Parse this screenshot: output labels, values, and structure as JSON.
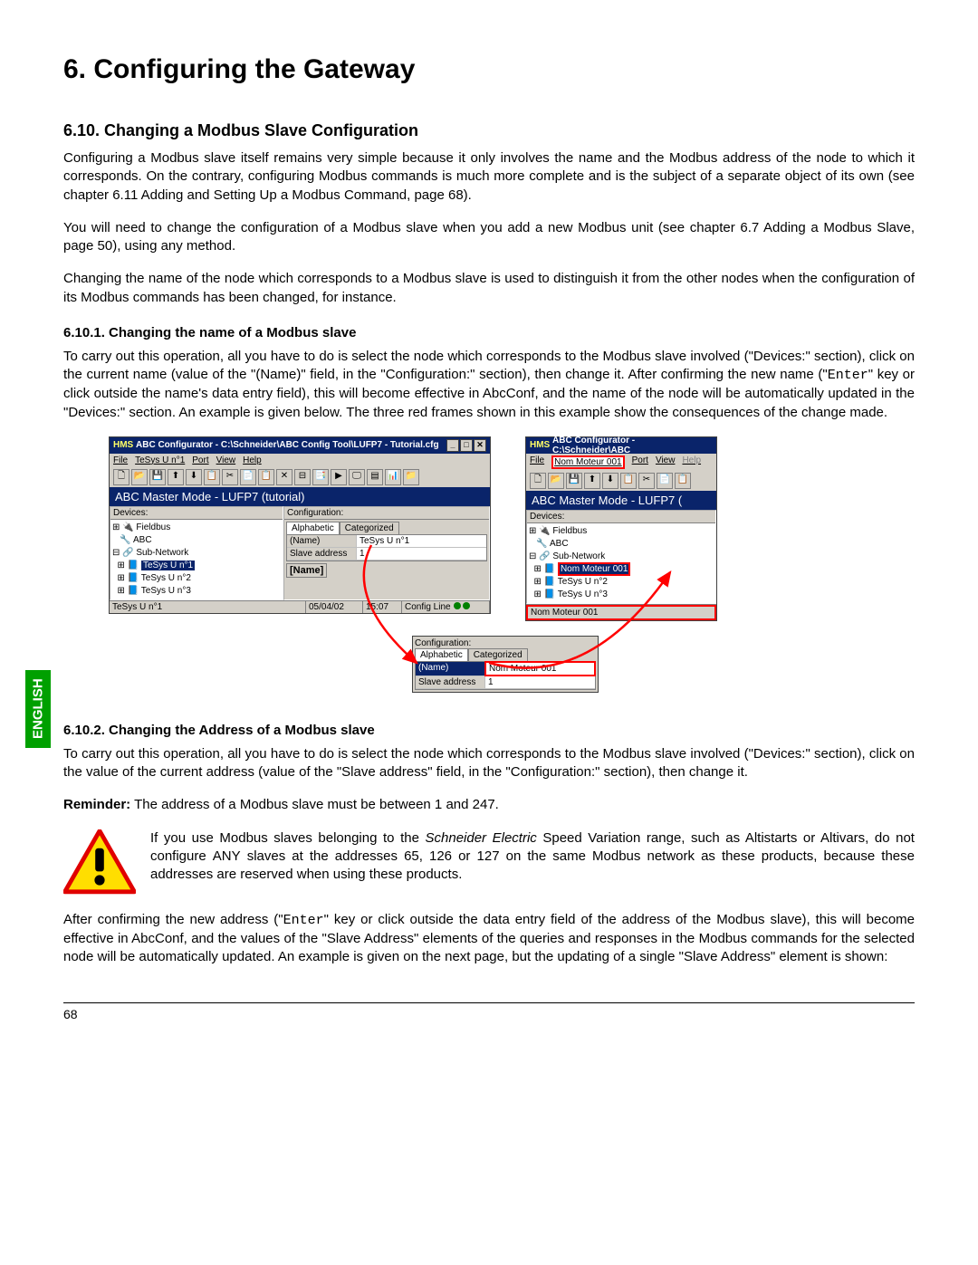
{
  "h1": "6. Configuring the Gateway",
  "h2": "6.10. Changing a Modbus Slave Configuration",
  "p1": "Configuring a Modbus slave itself remains very simple because it only involves the name and the Modbus address of the node to which it corresponds. On the contrary, configuring Modbus commands is much more complete and is the subject of a separate object of its own (see chapter 6.11 Adding and Setting Up a Modbus Command, page 68).",
  "p2": "You will need to change the configuration of a Modbus slave when you add a new Modbus unit (see chapter 6.7 Adding a Modbus Slave, page 50), using any method.",
  "p3": "Changing the name of the node which corresponds to a Modbus slave is used to distinguish it from the other nodes when the configuration of its Modbus commands has been changed, for instance.",
  "h3a": "6.10.1. Changing the name of a Modbus slave",
  "p4_a": "To carry out this operation, all you have to do is select the node which corresponds to the Modbus slave involved (\"Devices:\" section), click on the current name (value of the \"(Name)\" field, in the \"Configuration:\" section), then change it. After confirming the new name (\"",
  "enter": "Enter",
  "p4_b": "\" key or click outside the name's data entry field), this will become effective in AbcConf, and the name of the node will be automatically updated in the \"Devices:\" section. An example is given below. The three red frames shown in this example show the consequences of the change made.",
  "win_left": {
    "title": "ABC Configurator - C:\\Schneider\\ABC Config Tool\\LUFP7 - Tutorial.cfg",
    "menus": [
      "File",
      "TeSys U n°1",
      "Port",
      "View",
      "Help"
    ],
    "mode": "ABC Master Mode - LUFP7 (tutorial)",
    "devices_hdr": "Devices:",
    "tree": {
      "fieldbus": "Fieldbus",
      "abc": "ABC",
      "subnet": "Sub-Network",
      "n1": "TeSys U n°1",
      "n2": "TeSys U n°2",
      "n3": "TeSys U n°3"
    },
    "cfg_hdr": "Configuration:",
    "tab_alpha": "Alphabetic",
    "tab_cat": "Categorized",
    "name_lbl": "(Name)",
    "name_val": "TeSys U n°1",
    "slave_lbl": "Slave address",
    "slave_val": "1",
    "nm_section": "[Name]",
    "status_left": "TeSys U n°1",
    "status_date": "05/04/02",
    "status_time": "15:07",
    "status_cfg": "Config Line"
  },
  "win_right": {
    "title": "ABC Configurator - C:\\Schneider\\ABC",
    "menus": [
      "File",
      "Nom Moteur 001",
      "Port",
      "View",
      "Help"
    ],
    "mode": "ABC Master Mode - LUFP7 (",
    "devices_hdr": "Devices:",
    "tree": {
      "fieldbus": "Fieldbus",
      "abc": "ABC",
      "subnet": "Sub-Network",
      "n1": "Nom Moteur 001",
      "n2": "TeSys U n°2",
      "n3": "TeSys U n°3"
    },
    "status": "Nom Moteur 001"
  },
  "popup": {
    "hdr": "Configuration:",
    "tab_alpha": "Alphabetic",
    "tab_cat": "Categorized",
    "name_lbl": "(Name)",
    "name_val": "Nom Moteur 001",
    "slave_lbl": "Slave address",
    "slave_val": "1"
  },
  "h3b": "6.10.2. Changing the Address of a Modbus slave",
  "p5": "To carry out this operation, all you have to do is select the node which corresponds to the Modbus slave involved (\"Devices:\" section), click on the value of the current address (value of the \"Slave address\" field, in the \"Configuration:\" section), then change it.",
  "reminder_b": "Reminder:",
  "reminder_t": " The address of a Modbus slave must be between 1 and 247.",
  "warn_a": "If you use Modbus slaves belonging to the ",
  "warn_i": "Schneider Electric",
  "warn_b": " Speed Variation range, such as Altistarts or Altivars, do not configure ",
  "warn_sc": "ANY",
  "warn_c": " slaves at the addresses 65, 126 or 127 on the same Modbus network as these products, because these addresses are reserved when using these products.",
  "p6_a": "After confirming the new address (\"",
  "p6_b": "\" key or click outside the data entry field of the address of the Modbus slave), this will become effective in AbcConf, and the values of the \"Slave Address\" elements of the queries and responses in the Modbus commands for the selected node will be automatically updated. An example is given on the next page, but the updating of a single \"Slave Address\" element is shown:",
  "english": "ENGLISH",
  "pagenum": "68"
}
